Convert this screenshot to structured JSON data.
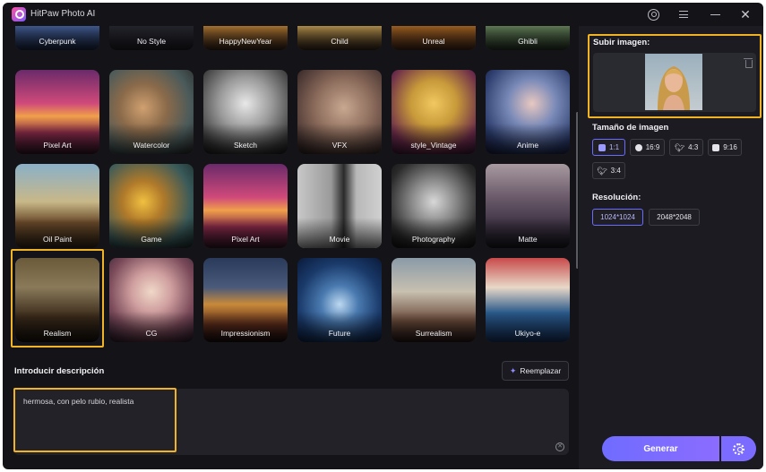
{
  "app": {
    "title": "HitPaw Photo AI"
  },
  "styles": {
    "row0": [
      "Cyberpunk",
      "No Style",
      "HappyNewYear",
      "Child",
      "Unreal",
      "Ghibli"
    ],
    "row1": [
      "Pixel Art",
      "Watercolor",
      "Sketch",
      "VFX",
      "style_Vintage",
      "Anime"
    ],
    "row2": [
      "Oil Paint",
      "Game",
      "Pixel Art",
      "Movie",
      "Photography",
      "Matte"
    ],
    "row3": [
      "Realism",
      "CG",
      "Impressionism",
      "Future",
      "Surrealism",
      "Ukiyo-e"
    ],
    "selected": "Realism"
  },
  "description": {
    "title": "Introducir descripción",
    "replace_label": "Reemplazar",
    "text": "hermosa, con pelo rubio, realista"
  },
  "panel": {
    "upload_title": "Subir imagen:",
    "size_title": "Tamaño de imagen",
    "sizes": [
      "1:1",
      "16:9",
      "4:3",
      "9:16",
      "3:4"
    ],
    "selected_size": "1:1",
    "resolution_title": "Resolución:",
    "resolutions": [
      "1024*1024",
      "2048*2048"
    ],
    "selected_resolution": "1024*1024",
    "generate_label": "Generar"
  },
  "colors": {
    "accent": "#6f6cff",
    "highlight": "#f0b323",
    "background": "#141418"
  }
}
